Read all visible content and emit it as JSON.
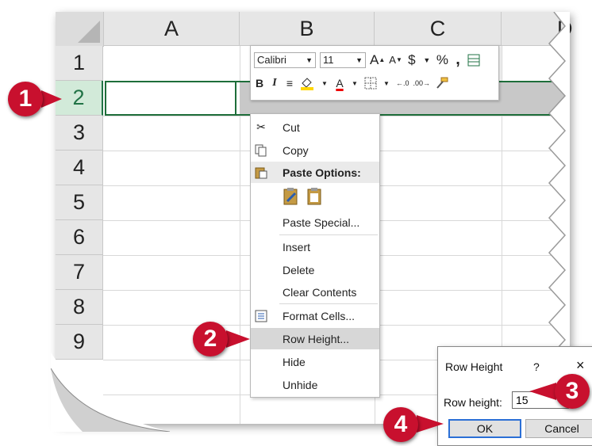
{
  "columns": [
    "A",
    "B",
    "C",
    "D"
  ],
  "rows": [
    "1",
    "2",
    "3",
    "4",
    "5",
    "6",
    "7",
    "8",
    "9"
  ],
  "mini_toolbar": {
    "font_name": "Calibri",
    "font_size": "11",
    "grow_font": "A",
    "shrink_font": "A",
    "currency": "$",
    "percent": "%",
    "comma": ",",
    "bold": "B",
    "italic": "I",
    "font_color": "A"
  },
  "context_menu": {
    "items": [
      {
        "label": "Cut",
        "icon": "scissors-icon"
      },
      {
        "label": "Copy",
        "icon": "copy-icon"
      },
      {
        "label": "Paste Options:",
        "icon": "paste-icon"
      },
      {
        "label": "Paste Special..."
      },
      {
        "label": "Insert"
      },
      {
        "label": "Delete"
      },
      {
        "label": "Clear Contents"
      },
      {
        "label": "Format Cells...",
        "icon": "format-cells-icon"
      },
      {
        "label": "Row Height..."
      },
      {
        "label": "Hide"
      },
      {
        "label": "Unhide"
      }
    ]
  },
  "dialog": {
    "title": "Row Height",
    "help": "?",
    "close": "×",
    "label": "Row height:",
    "value": "15",
    "ok": "OK",
    "cancel": "Cancel"
  },
  "callouts": [
    "1",
    "2",
    "3",
    "4"
  ],
  "colors": {
    "selection_green": "#1e6e3a",
    "header_selected": "#d2ead9",
    "callout_red": "#c8102e",
    "ok_border": "#2b6fd6"
  }
}
